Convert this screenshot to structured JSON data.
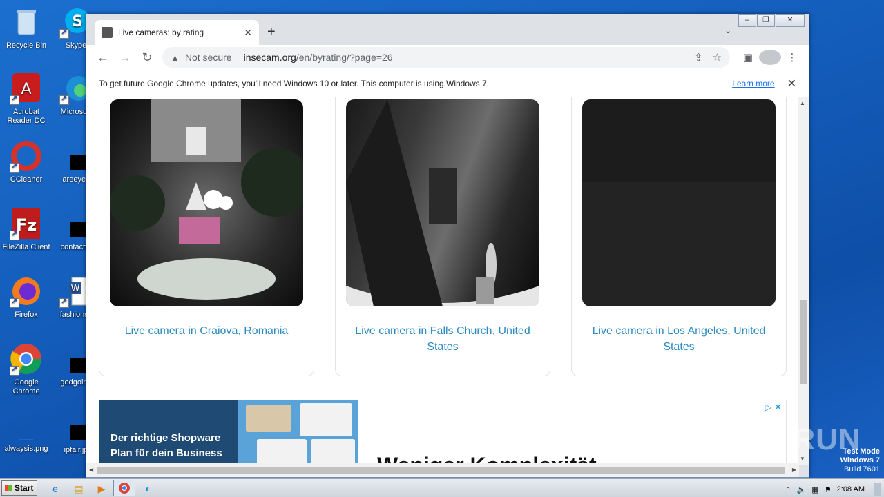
{
  "desktop": {
    "icons": [
      {
        "label": "Recycle Bin",
        "icon": "recycle-bin-icon"
      },
      {
        "label": "Acrobat Reader DC",
        "icon": "acrobat-icon"
      },
      {
        "label": "CCleaner",
        "icon": "ccleaner-icon"
      },
      {
        "label": "FileZilla Client",
        "icon": "filezilla-icon"
      },
      {
        "label": "Firefox",
        "icon": "firefox-icon"
      },
      {
        "label": "Google Chrome",
        "icon": "chrome-icon"
      },
      {
        "label": "alwaysis.png",
        "icon": "image-file-icon"
      },
      {
        "label": "Skype",
        "icon": "skype-icon"
      },
      {
        "label": "Microsoft",
        "icon": "edge-icon"
      },
      {
        "label": "areeyes",
        "icon": "file-icon"
      },
      {
        "label": "contactfri",
        "icon": "file-icon"
      },
      {
        "label": "fashionsy",
        "icon": "word-icon"
      },
      {
        "label": "godgoing",
        "icon": "file-icon"
      },
      {
        "label": "ipfair.jp",
        "icon": "file-icon"
      }
    ]
  },
  "browser": {
    "tab_title": "Live cameras: by rating",
    "url_not_secure": "Not secure",
    "url_domain": "insecam.org",
    "url_path": "/en/byrating/?page=26",
    "infobar_message": "To get future Google Chrome updates, you'll need Windows 10 or later. This computer is using Windows 7.",
    "infobar_link": "Learn more"
  },
  "cameras": [
    {
      "caption": "Live camera in Craiova, Romania"
    },
    {
      "caption": "Live camera in Falls Church, United States"
    },
    {
      "caption": "Live camera in Los Angeles, United States"
    }
  ],
  "ad": {
    "left_text": "Der richtige Shopware Plan für dein Business",
    "headline": "Weniger Komplexität."
  },
  "system": {
    "watermark": "ANY RUN",
    "testmode_line1": "Test Mode",
    "testmode_line2": "Windows 7",
    "testmode_line3": "Build 7601",
    "start_label": "Start",
    "clock": "2:08 AM"
  }
}
